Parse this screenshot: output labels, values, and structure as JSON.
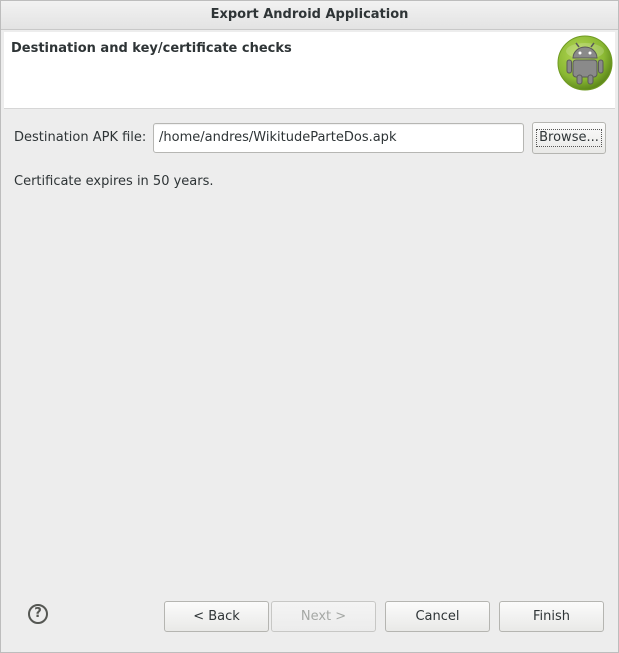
{
  "window": {
    "title": "Export Android Application"
  },
  "banner": {
    "title": "Destination and key/certificate checks",
    "icon": "android-logo-icon"
  },
  "destination": {
    "label": "Destination APK file:",
    "value": "/home/andres/WikitudeParteDos.apk",
    "browse_label": "Browse..."
  },
  "status": {
    "message": "Certificate expires in 50 years."
  },
  "footer": {
    "help_glyph": "?",
    "back_label": "< Back",
    "next_label": "Next >",
    "cancel_label": "Cancel",
    "finish_label": "Finish"
  },
  "colors": {
    "android_green": "#8ab833",
    "window_bg": "#ededed",
    "banner_bg": "#ffffff"
  }
}
